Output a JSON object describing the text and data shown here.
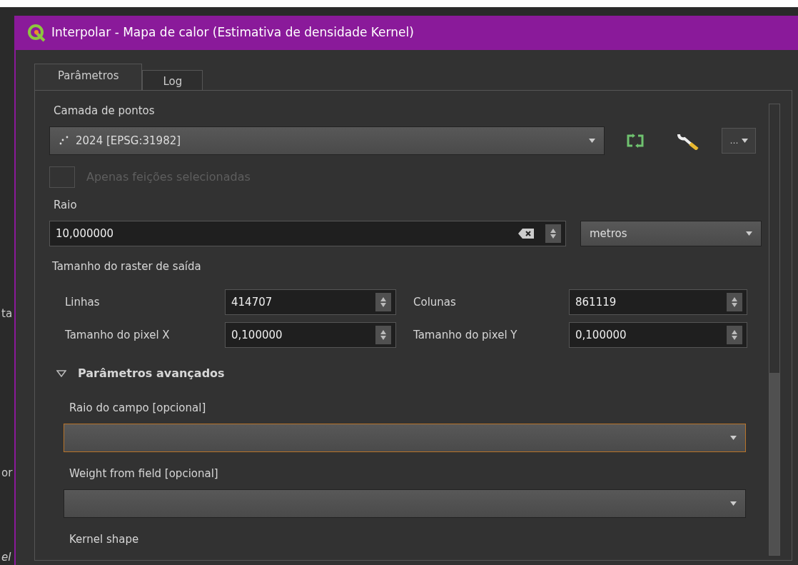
{
  "window": {
    "title": "Interpolar - Mapa de calor (Estimativa de densidade Kernel)"
  },
  "background_texts": [
    "ta",
    "or",
    "el"
  ],
  "tabs": [
    {
      "label": "Parâmetros",
      "selected": true
    },
    {
      "label": "Log",
      "selected": false
    }
  ],
  "point_layer": {
    "label": "Camada de pontos",
    "value": "2024 [EPSG:31982]",
    "more_button": "…"
  },
  "selected_only": {
    "label": "Apenas feições selecionadas",
    "checked": false,
    "disabled": true
  },
  "radius": {
    "label": "Raio",
    "value": "10,000000",
    "unit": "metros"
  },
  "output_raster": {
    "label": "Tamanho do raster de saída",
    "fields": [
      {
        "label": "Linhas",
        "value": "414707"
      },
      {
        "label": "Colunas",
        "value": "861119"
      },
      {
        "label": "Tamanho do pixel X",
        "value": "0,100000"
      },
      {
        "label": "Tamanho do pixel Y",
        "value": "0,100000"
      }
    ]
  },
  "advanced": {
    "label": "Parâmetros avançados",
    "expanded": true,
    "fields": [
      {
        "label": "Raio do campo [opcional]",
        "kind": "combo",
        "focused": true
      },
      {
        "label": "Weight from field [opcional]",
        "kind": "combo",
        "focused": false
      },
      {
        "label": "Kernel shape",
        "kind": "label"
      }
    ]
  }
}
